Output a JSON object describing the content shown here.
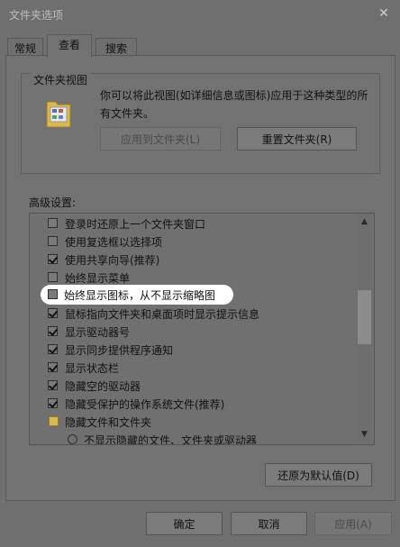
{
  "window": {
    "title": "文件夹选项",
    "close_glyph": "✕"
  },
  "tabs": [
    {
      "label": "常规",
      "active": false
    },
    {
      "label": "查看",
      "active": true
    },
    {
      "label": "搜索",
      "active": false
    }
  ],
  "folder_views": {
    "group_title": "文件夹视图",
    "description": "你可以将此视图(如详细信息或图标)应用于这种类型的所有文件夹。",
    "apply_button": "应用到文件夹(L)",
    "reset_button": "重置文件夹(R)"
  },
  "advanced": {
    "label": "高级设置:",
    "items": [
      {
        "type": "checkbox",
        "checked": false,
        "label": "登录时还原上一个文件夹窗口"
      },
      {
        "type": "checkbox",
        "checked": false,
        "label": "使用复选框以选择项"
      },
      {
        "type": "checkbox",
        "checked": true,
        "label": "使用共享向导(推荐)"
      },
      {
        "type": "checkbox",
        "checked": false,
        "label": "始终显示菜单"
      },
      {
        "type": "checkbox",
        "checked": false,
        "label": "始终显示图标，从不显示缩略图",
        "highlighted": true
      },
      {
        "type": "checkbox",
        "checked": true,
        "label": "鼠标指向文件夹和桌面项时显示提示信息"
      },
      {
        "type": "checkbox",
        "checked": true,
        "label": "显示驱动器号"
      },
      {
        "type": "checkbox",
        "checked": true,
        "label": "显示同步提供程序通知"
      },
      {
        "type": "checkbox",
        "checked": true,
        "label": "显示状态栏"
      },
      {
        "type": "checkbox",
        "checked": true,
        "label": "隐藏空的驱动器"
      },
      {
        "type": "checkbox",
        "checked": true,
        "label": "隐藏受保护的操作系统文件(推荐)"
      },
      {
        "type": "folder",
        "label": "隐藏文件和文件夹"
      },
      {
        "type": "radio",
        "label": "不显示隐藏的文件、文件夹或驱动器"
      }
    ],
    "restore_defaults_button": "还原为默认值(D)"
  },
  "footer": {
    "ok_button": "确定",
    "cancel_button": "取消",
    "apply_button": "应用(A)"
  },
  "colors": {
    "highlight": "#ffffff",
    "folder": "#d9b85a"
  }
}
